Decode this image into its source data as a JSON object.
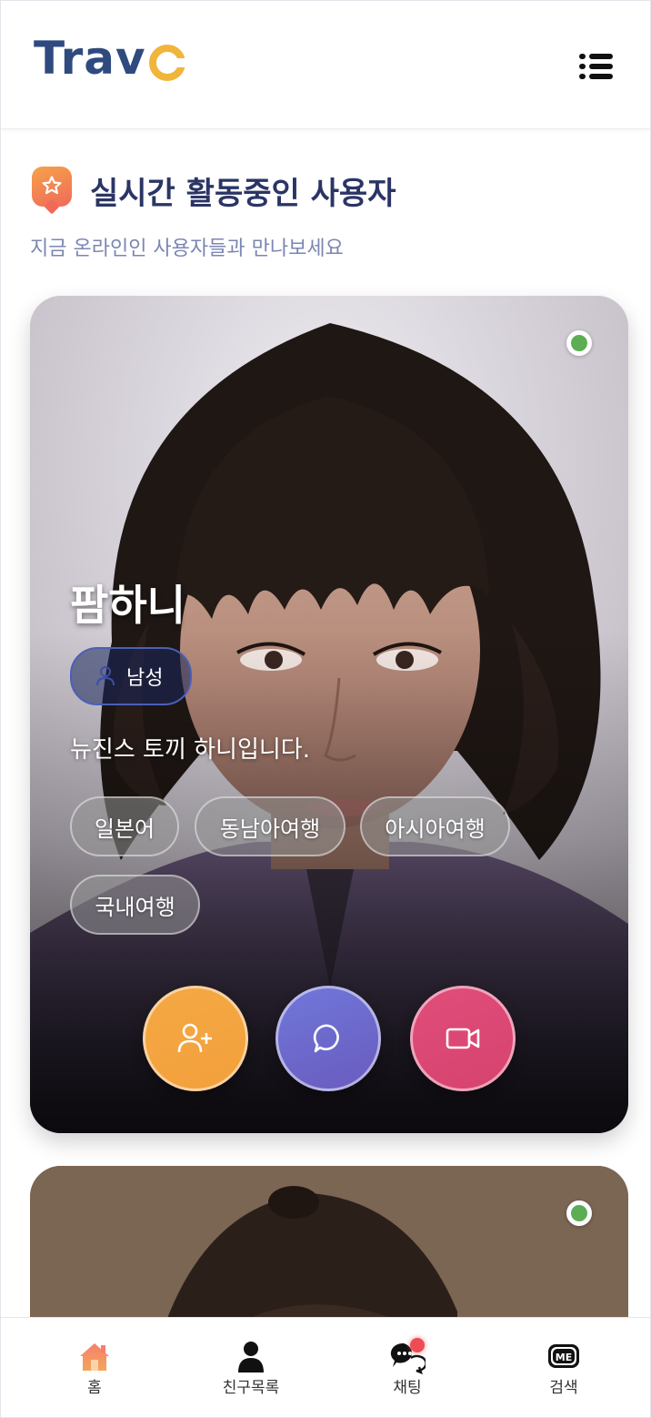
{
  "app": {
    "brand_prefix": "Trav",
    "brand_suffix": "o",
    "menu_icon": "list-menu-icon"
  },
  "section": {
    "icon": "star-badge-icon",
    "title": "실시간 활동중인 사용자",
    "subtitle": "지금 온라인인 사용자들과 만나보세요"
  },
  "cards": [
    {
      "name": "팜하니",
      "online": true,
      "gender_icon": "user-icon",
      "gender": "남성",
      "bio": "뉴진스 토끼 하니입니다.",
      "tags": [
        "일본어",
        "동남아여행",
        "아시아여행",
        "국내여행"
      ],
      "actions": [
        {
          "icon": "add-friend-icon",
          "color": "#F4A641"
        },
        {
          "icon": "chat-bubble-icon",
          "color": "#6E6BD0"
        },
        {
          "icon": "video-call-icon",
          "color": "#DE4A77"
        }
      ]
    },
    {
      "online": true
    }
  ],
  "bottom_nav": [
    {
      "label": "홈",
      "icon": "home-icon",
      "active": true
    },
    {
      "label": "친구목록",
      "icon": "friends-icon",
      "active": false
    },
    {
      "label": "채팅",
      "icon": "chat-icon",
      "badge": true
    },
    {
      "label": "검색",
      "icon": "me-icon",
      "icon_text": "ME"
    }
  ],
  "colors": {
    "brand_blue": "#2F4A7F",
    "brand_yellow": "#F0B53A",
    "online_green": "#5CAD54",
    "title_navy": "#2B3565",
    "subtitle": "#7B86B3"
  }
}
